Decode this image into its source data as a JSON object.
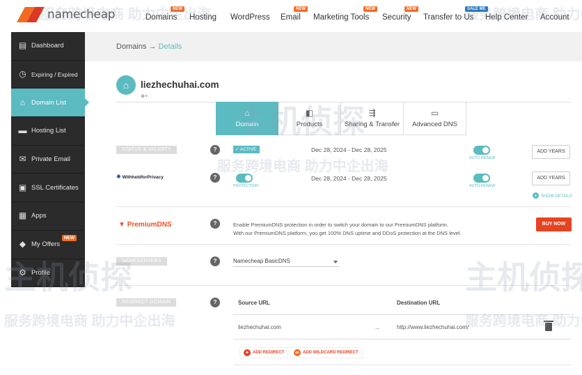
{
  "brand": {
    "logo_text": "namecheap",
    "accent": "#5bbbc1",
    "orange": "#f26b21"
  },
  "nav": {
    "items": [
      {
        "label": "Domains",
        "badge": "NEW"
      },
      {
        "label": "Hosting",
        "badge": ""
      },
      {
        "label": "WordPress",
        "badge": ""
      },
      {
        "label": "Email",
        "badge": "NEW"
      },
      {
        "label": "Marketing Tools",
        "badge": "NEW"
      },
      {
        "label": "Security",
        "badge": "NEW"
      },
      {
        "label": "Transfer to Us",
        "badge": "SALE ME"
      },
      {
        "label": "Help Center",
        "badge": ""
      },
      {
        "label": "Account",
        "badge": ""
      }
    ]
  },
  "sidebar": {
    "items": [
      {
        "label": "Dashboard",
        "icon": "dashboard-icon"
      },
      {
        "label": "Expiring / Expired",
        "icon": "clock-icon"
      },
      {
        "label": "Domain List",
        "icon": "home-icon",
        "active": true
      },
      {
        "label": "Hosting List",
        "icon": "server-icon"
      },
      {
        "label": "Private Email",
        "icon": "mail-icon"
      },
      {
        "label": "SSL Certificates",
        "icon": "lock-icon"
      },
      {
        "label": "Apps",
        "icon": "apps-icon"
      },
      {
        "label": "My Offers",
        "icon": "tag-icon",
        "badge": "NEW"
      },
      {
        "label": "Profile",
        "icon": "gear-icon"
      }
    ]
  },
  "breadcrumb": {
    "root": "Domains",
    "sep": "→",
    "current": "Details"
  },
  "domain": {
    "name": "liezhechuhai.com"
  },
  "tabs": [
    {
      "label": "Domain",
      "icon": "home-icon",
      "active": true
    },
    {
      "label": "Products",
      "icon": "box-icon"
    },
    {
      "label": "Sharing & Transfer",
      "icon": "share-icon"
    },
    {
      "label": "Advanced DNS",
      "icon": "dns-icon"
    }
  ],
  "status": {
    "label": "STATUS & VALIDITY",
    "pill": "ACTIVE",
    "dates": "Dec 28, 2024 - Dec 28, 2025",
    "auto_renew": "AUTO-RENEW",
    "add_years": "ADD YEARS"
  },
  "privacy": {
    "brand": "WithheldforPrivacy",
    "protection": "PROTECTION",
    "dates": "Dec 28, 2024 - Dec 28, 2025",
    "auto_renew": "AUTO-RENEW",
    "add_years": "ADD YEARS",
    "show_details": "SHOW DETAILS"
  },
  "premium": {
    "brand": "PremiumDNS",
    "line1": "Enable PremiumDNS protection in order to switch your domain to our PremiumDNS platform.",
    "line2": "With our PremiumDNS platform, you get 100% DNS uptime and DDoS protection at the DNS level.",
    "buy": "BUY NOW"
  },
  "nameservers": {
    "label": "NAMESERVERS",
    "value": "Namecheap BasicDNS"
  },
  "redirect": {
    "label": "REDIRECT DOMAIN",
    "col_source": "Source URL",
    "col_dest": "Destination URL",
    "source": "liezhechuhai.com",
    "arrow": "→",
    "dest": "http://www.liezhechuhai.com/",
    "add_redirect": "ADD REDIRECT",
    "add_wildcard": "ADD WILDCARD REDIRECT"
  },
  "help": "?",
  "watermark": {
    "cn_text": "服务跨境电商 助力中企出海",
    "logo_text": "主机侦探"
  }
}
